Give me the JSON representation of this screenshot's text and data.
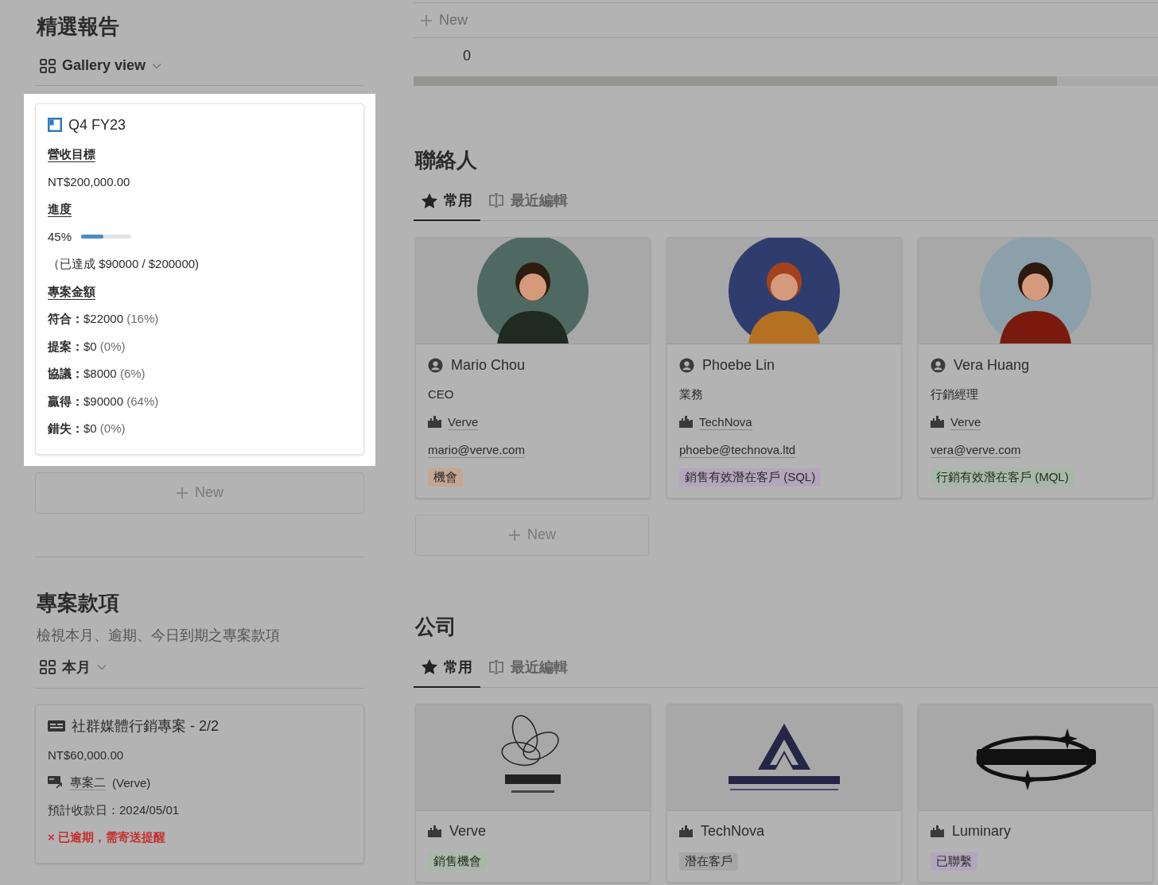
{
  "report": {
    "title": "精選報告",
    "view": "Gallery view",
    "card": {
      "title": "Q4 FY23",
      "fields": [
        {
          "kind": "heading",
          "text": "營收目標"
        },
        {
          "kind": "text",
          "text": "NT$200,000.00"
        },
        {
          "kind": "heading",
          "text": "進度"
        },
        {
          "kind": "progress",
          "reading": "45%",
          "level": 0.45
        },
        {
          "kind": "text",
          "text": "（已達成 $90000 / $200000)"
        },
        {
          "kind": "heading",
          "text": "專案金額"
        },
        {
          "kind": "stage",
          "text": "**符合：**$22000",
          "share": "(16%)"
        },
        {
          "kind": "stage",
          "text": "**提案：**$0",
          "share": "(0%)"
        },
        {
          "kind": "stage",
          "text": "**協議：**$8000",
          "share": "(6%)"
        },
        {
          "kind": "stage",
          "text": "**贏得：**$90000",
          "share": "(64%)"
        },
        {
          "kind": "stage",
          "text": "**錯失：**$0",
          "share": "(0%)"
        }
      ]
    },
    "new_button": "New"
  },
  "payments": {
    "title": "專案款項",
    "description": "檢視本月、逾期、今日到期之專案款項",
    "view": "本月",
    "card": {
      "title": "社群媒體行銷專案 - 2/2",
      "amount": "NT$60,000.00",
      "project": "專案二",
      "project_suffix": "(Verve)",
      "due": "預計收款日：2024/05/01",
      "status": {
        "icon": "×",
        "text": "已逾期，需寄送提醒"
      }
    }
  },
  "table": {
    "new_row": "New",
    "cell": "0"
  },
  "contacts": {
    "title": "聯絡人",
    "tabs": [
      {
        "label": "常用",
        "selected": true
      },
      {
        "label": "最近編輯",
        "selected": false
      }
    ],
    "cards": [
      {
        "name": "Mario Chou",
        "role": "CEO",
        "company": "Verve",
        "email": "mario@verve.com",
        "tag": {
          "label": "機會",
          "color": "#c4a792"
        }
      },
      {
        "name": "Phoebe Lin",
        "role": "業務",
        "company": "TechNova",
        "email": "phoebe@technova.ltd",
        "tag": {
          "label": "銷售有效潛在客戶 (SQL)",
          "color": "#b3a6bc"
        }
      },
      {
        "name": "Vera Huang",
        "role": "行銷經理",
        "company": "Verve",
        "email": "vera@verve.com",
        "tag": {
          "label": "行銷有效潛在客戶 (MQL)",
          "color": "#a6b9a6"
        }
      }
    ],
    "new_button": "New"
  },
  "companies": {
    "title": "公司",
    "tabs": [
      {
        "label": "常用",
        "selected": true
      },
      {
        "label": "最近編輯",
        "selected": false
      }
    ],
    "cards": [
      {
        "name": "Verve",
        "tag": {
          "label": "銷售機會",
          "color": "#a6b9a6"
        }
      },
      {
        "name": "TechNova",
        "tag": {
          "label": "潛在客戶",
          "color": "#a6a6a6"
        }
      },
      {
        "name": "Luminary",
        "tag": {
          "label": "已聯繫",
          "color": "#b3a6bc"
        }
      }
    ]
  }
}
